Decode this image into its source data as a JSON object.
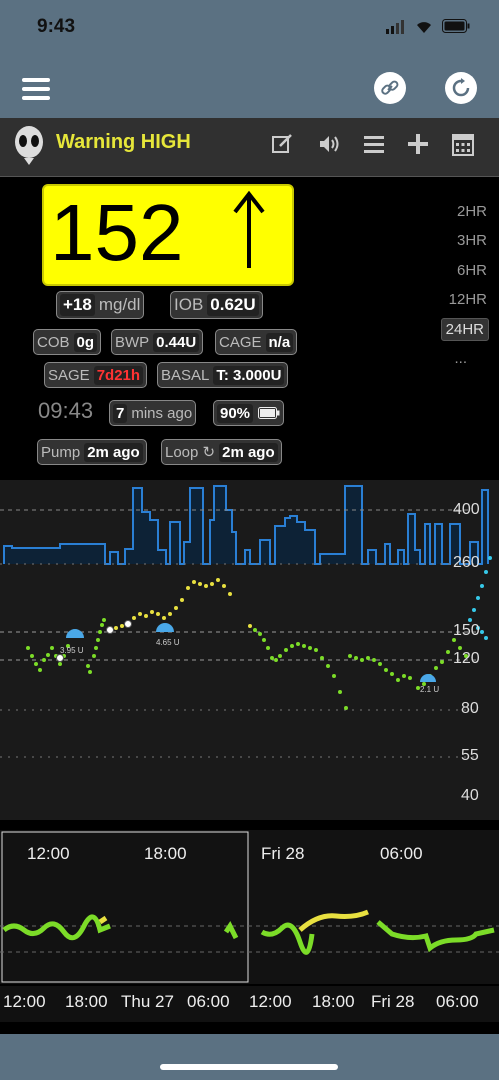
{
  "status": {
    "time": "9:43"
  },
  "header": {
    "title": "Warning HIGH"
  },
  "bg": {
    "value": "152",
    "arrow": "↑"
  },
  "pills": {
    "delta": "+18",
    "delta_unit": "mg/dl",
    "iob_label": "IOB",
    "iob": "0.62U",
    "cob_label": "COB",
    "cob": "0g",
    "bwp_label": "BWP",
    "bwp": "0.44U",
    "cage_label": "CAGE",
    "cage": "n/a",
    "sage_label": "SAGE",
    "sage": "7d21h",
    "basal_label": "BASAL",
    "basal": "T: 3.000U",
    "ago": "7",
    "ago_label": "mins ago",
    "battery": "90%",
    "pump_label": "Pump",
    "pump": "2m ago",
    "loop_label": "Loop ↻",
    "loop": "2m ago"
  },
  "clock": "09:43",
  "ranges": [
    "2HR",
    "3HR",
    "6HR",
    "12HR",
    "24HR",
    "..."
  ],
  "chart_ticks": [
    "400",
    "260",
    "150",
    "120",
    "80",
    "55",
    "40"
  ],
  "treatments": [
    "3.95 U",
    "4.65 U",
    "2.1 U"
  ],
  "nav": {
    "top_labels": [
      "12:00",
      "18:00",
      "Fri 28",
      "06:00"
    ],
    "bottom_labels": [
      "12:00",
      "18:00",
      "Thu 27",
      "06:00",
      "12:00",
      "18:00",
      "Fri 28",
      "06:00"
    ]
  }
}
